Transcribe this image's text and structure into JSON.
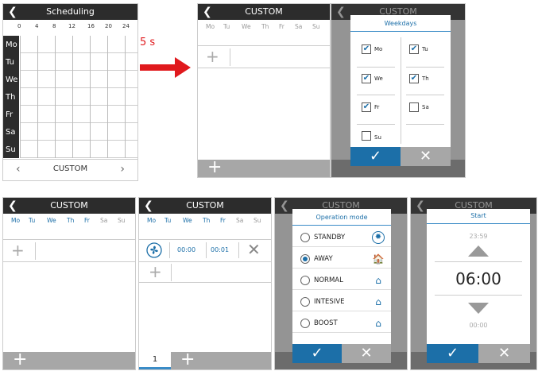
{
  "screen1": {
    "title": "Scheduling",
    "hours": [
      "0",
      "4",
      "8",
      "12",
      "16",
      "20",
      "24"
    ],
    "days": [
      "Mo",
      "Tu",
      "We",
      "Th",
      "Fr",
      "Sa",
      "Su"
    ],
    "mode_label": "CUSTOM",
    "prev": "‹",
    "next": "›"
  },
  "arrow_label": "5 s",
  "custom": {
    "title": "CUSTOM",
    "weekdays": [
      "Mo",
      "Tu",
      "We",
      "Th",
      "Fr",
      "Sa",
      "Su"
    ]
  },
  "weekdays_dialog": {
    "title": "Weekdays",
    "items": [
      {
        "label": "Mo",
        "checked": true
      },
      {
        "label": "Tu",
        "checked": true
      },
      {
        "label": "We",
        "checked": true
      },
      {
        "label": "Th",
        "checked": true
      },
      {
        "label": "Fr",
        "checked": true
      },
      {
        "label": "Sa",
        "checked": false
      },
      {
        "label": "Su",
        "checked": false
      }
    ]
  },
  "period": {
    "start": "00:00",
    "end": "00:01"
  },
  "page_tab": "1",
  "operation_dialog": {
    "title": "Operation mode",
    "options": [
      "STANDBY",
      "AWAY",
      "NORMAL",
      "INTESIVE",
      "BOOST"
    ],
    "selected": "AWAY"
  },
  "start_dialog": {
    "title": "Start",
    "prev_value": "23:59",
    "value": "06:00",
    "next_value": "00:00"
  },
  "colors": {
    "accent": "#1c6fa8",
    "header": "#2c2c2c",
    "footer": "#a7a7a7",
    "arrow": "#e0191d"
  }
}
